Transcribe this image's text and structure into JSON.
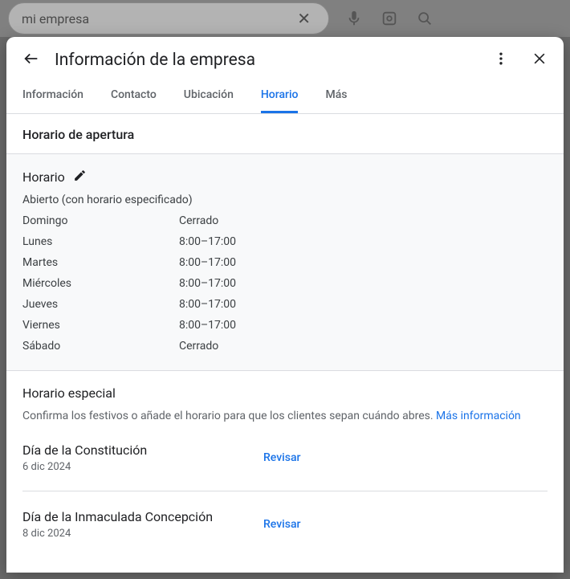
{
  "search": {
    "value": "mi empresa"
  },
  "modal": {
    "title": "Información de la empresa",
    "tabs": [
      {
        "label": "Información",
        "active": false
      },
      {
        "label": "Contacto",
        "active": false
      },
      {
        "label": "Ubicación",
        "active": false
      },
      {
        "label": "Horario",
        "active": true
      },
      {
        "label": "Más",
        "active": false
      }
    ]
  },
  "opening_hours": {
    "section_title": "Horario de apertura",
    "heading": "Horario",
    "status": "Abierto (con horario especificado)",
    "days": [
      {
        "day": "Domingo",
        "hours": "Cerrado"
      },
      {
        "day": "Lunes",
        "hours": "8:00–17:00"
      },
      {
        "day": "Martes",
        "hours": "8:00–17:00"
      },
      {
        "day": "Miércoles",
        "hours": "8:00–17:00"
      },
      {
        "day": "Jueves",
        "hours": "8:00–17:00"
      },
      {
        "day": "Viernes",
        "hours": "8:00–17:00"
      },
      {
        "day": "Sábado",
        "hours": "Cerrado"
      }
    ]
  },
  "special_hours": {
    "heading": "Horario especial",
    "description": "Confirma los festivos o añade el horario para que los clientes sepan cuándo abres. ",
    "more_info": "Más información",
    "holidays": [
      {
        "name": "Día de la Constitución",
        "date": "6 dic 2024",
        "action": "Revisar"
      },
      {
        "name": "Día de la Inmaculada Concepción",
        "date": "8 dic 2024",
        "action": "Revisar"
      }
    ]
  }
}
